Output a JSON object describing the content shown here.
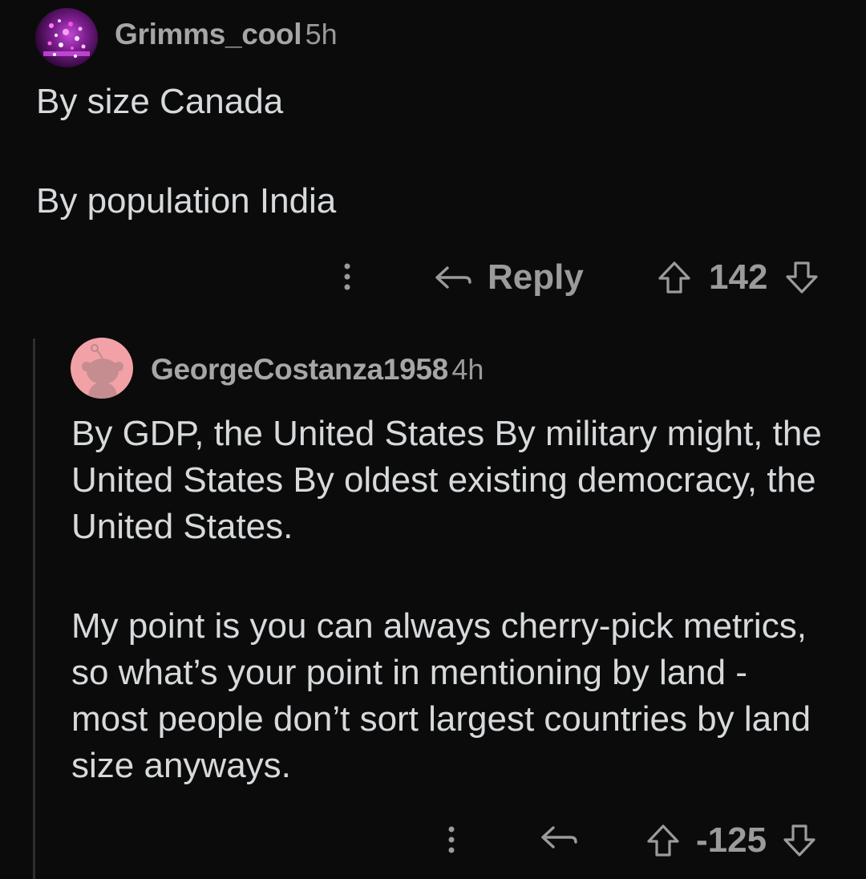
{
  "comments": [
    {
      "username": "Grimms_cool",
      "time": "5h",
      "paragraphs": [
        "By size Canada",
        "By population India"
      ],
      "reply_label": "Reply",
      "score": "142"
    },
    {
      "username": "GeorgeCostanza1958",
      "time": "4h",
      "paragraphs": [
        "By GDP, the United States By military might, the United States By oldest existing democracy, the United States.",
        "My point is you can always cherry-pick metrics, so what’s your point in mentioning by land - most people don’t sort largest countries by land size anyways."
      ],
      "score": "-125"
    }
  ],
  "icons": {
    "more": "vertical-dots-icon",
    "reply": "reply-arrow-icon",
    "upvote": "upvote-arrow-icon",
    "downvote": "downvote-arrow-icon"
  },
  "colors": {
    "background": "#0b0b0b",
    "text": "#d7dadc",
    "muted": "#9b9b9b",
    "avatar2": "#f2a2a7"
  }
}
